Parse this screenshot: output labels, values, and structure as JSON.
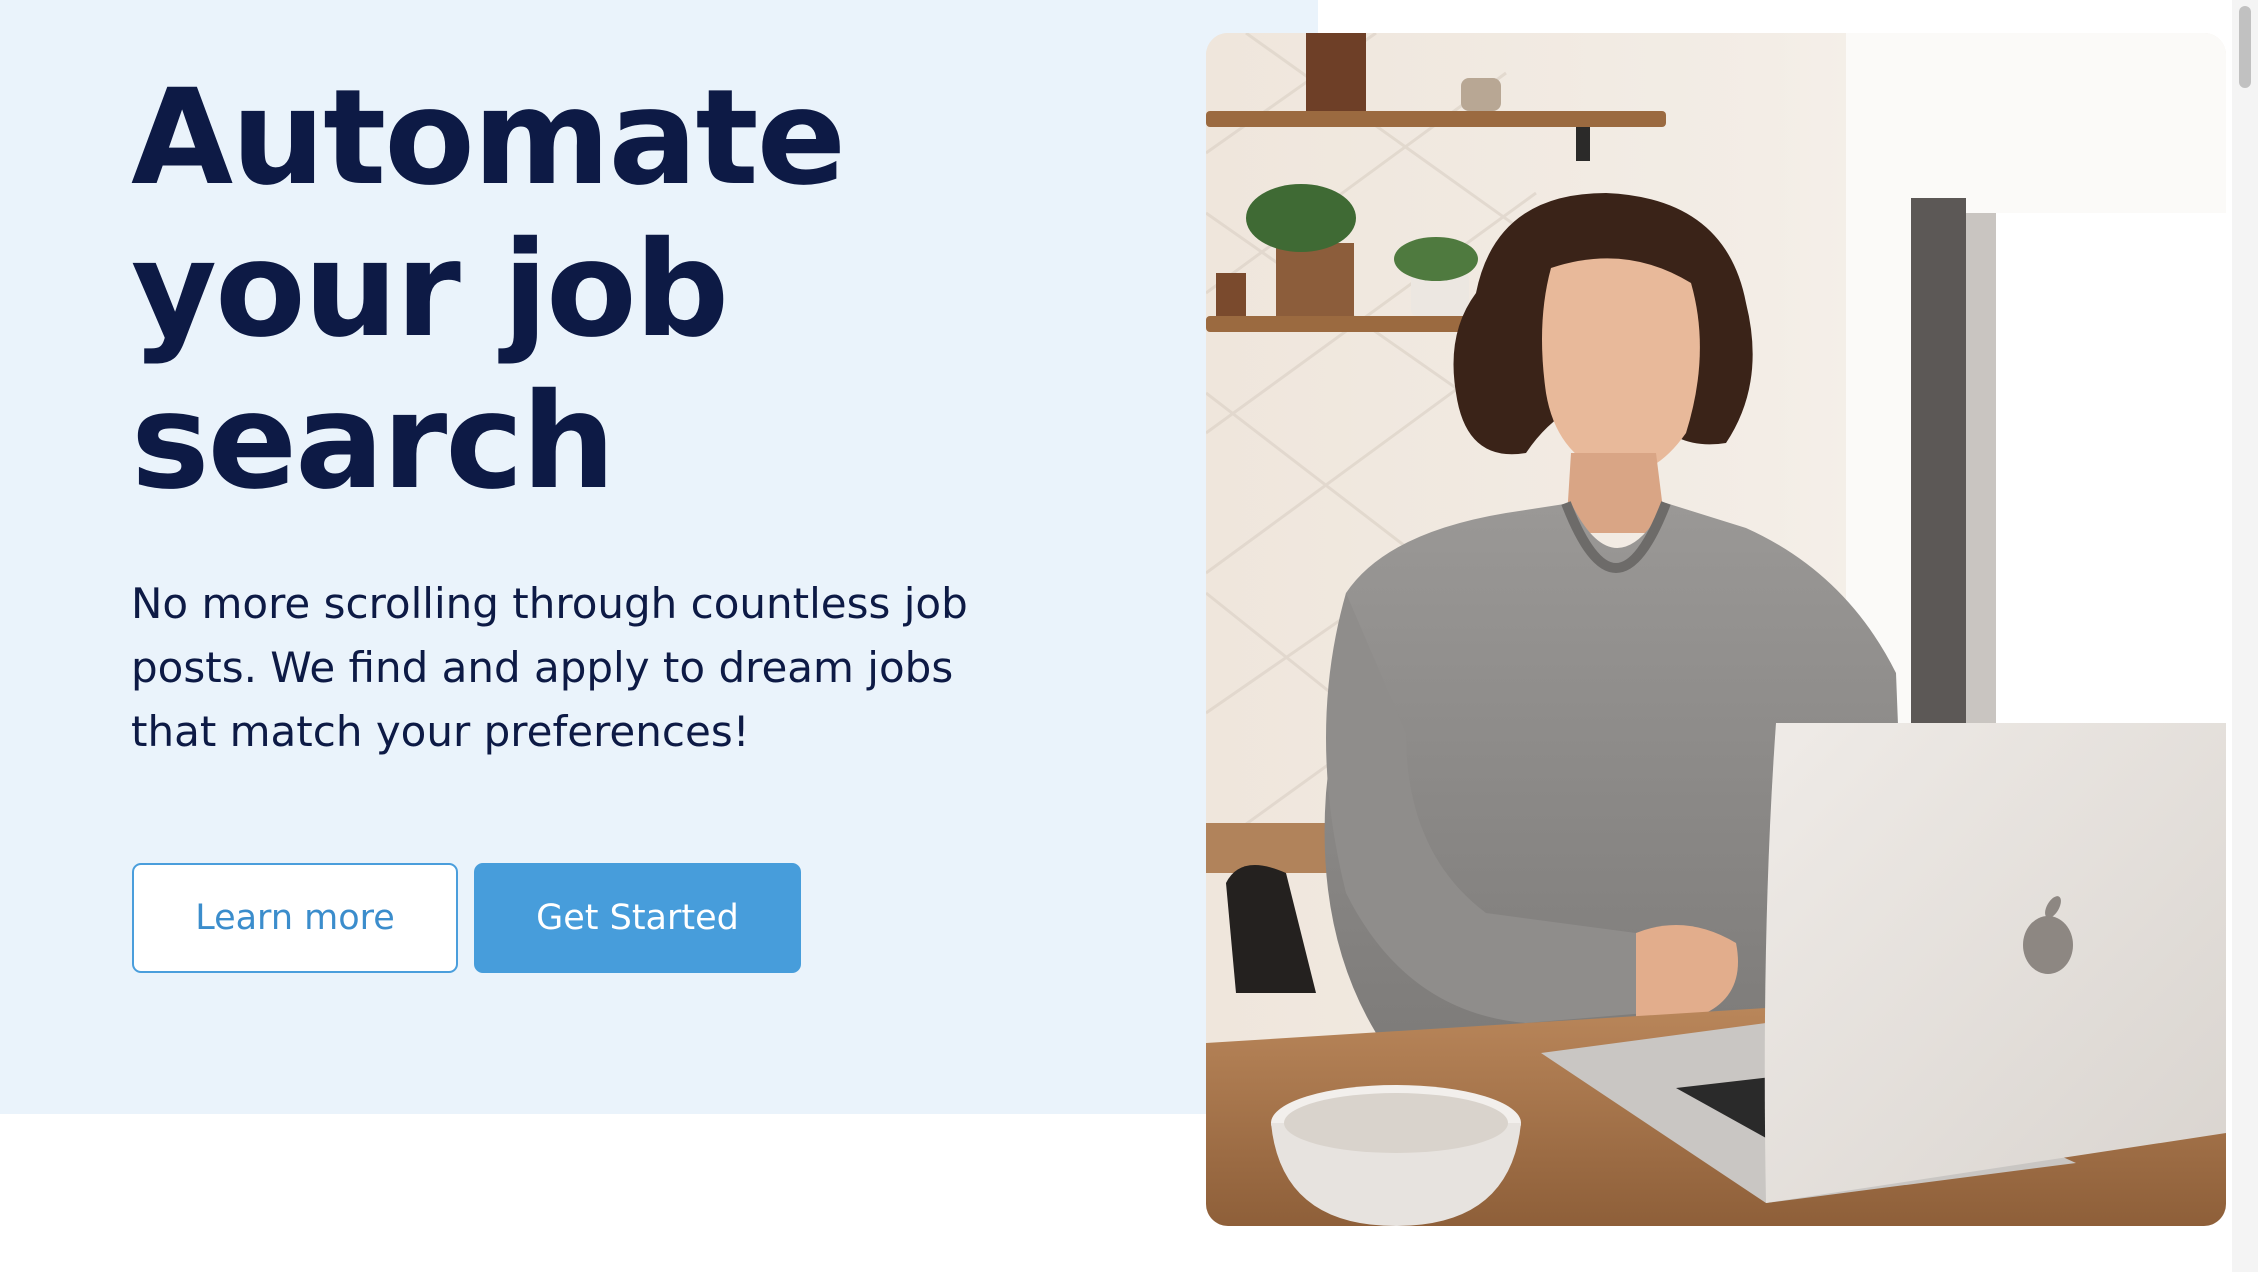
{
  "hero": {
    "title_lines": [
      "Automate",
      "your job",
      "search"
    ],
    "subtitle": "No more scrolling through countless job posts. We find and apply to dream jobs that match your preferences!",
    "learn_more_label": "Learn more",
    "get_started_label": "Get Started"
  },
  "colors": {
    "hero_background": "#eaf3fb",
    "heading_text": "#0d1a45",
    "accent_blue": "#479ddb"
  },
  "image": {
    "subject": "woman in grey sweater typing on a laptop at a wooden table in a kitchen"
  }
}
